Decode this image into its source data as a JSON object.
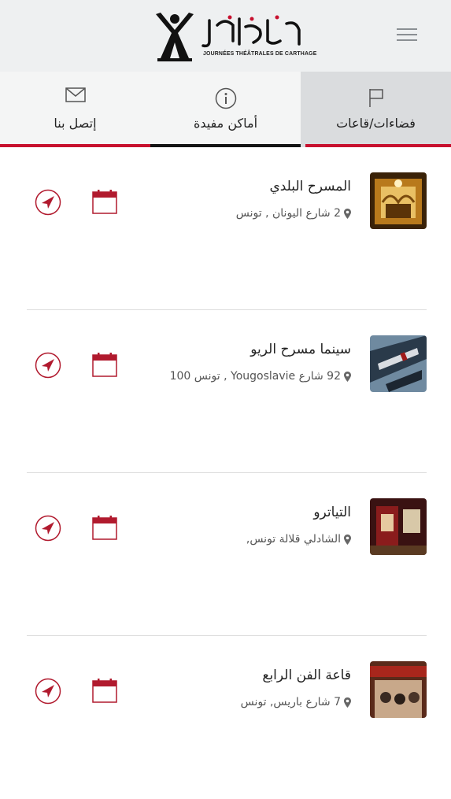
{
  "header": {
    "logo_arabic": "أيام قرطاج المسرحية",
    "logo_subtitle": "JOURNÉES THÉÂTRALES DE CARTHAGE",
    "menu_icon": "hamburger-menu-icon"
  },
  "tabs": [
    {
      "label": "فضاءات/قاعات",
      "icon": "flag-icon",
      "active": true
    },
    {
      "label": "أماكن مفيدة",
      "icon": "info-icon",
      "active": false
    },
    {
      "label": "إتصل بنا",
      "icon": "envelope-icon",
      "active": false
    }
  ],
  "venues": [
    {
      "title": "المسرح البلدي",
      "address": "2 شارع اليونان , تونس"
    },
    {
      "title": "سينما مسرح الريو",
      "address": "92 شارع Yougoslavie , تونس 100"
    },
    {
      "title": "التياترو",
      "address": "الشادلي قلالة تونس,"
    },
    {
      "title": "قاعة الفن الرابع",
      "address": "7 شارع باريس, تونس"
    }
  ],
  "colors": {
    "accent": "#c7102e",
    "header_bg": "#eef0f1",
    "active_tab_bg": "#dadcde"
  }
}
